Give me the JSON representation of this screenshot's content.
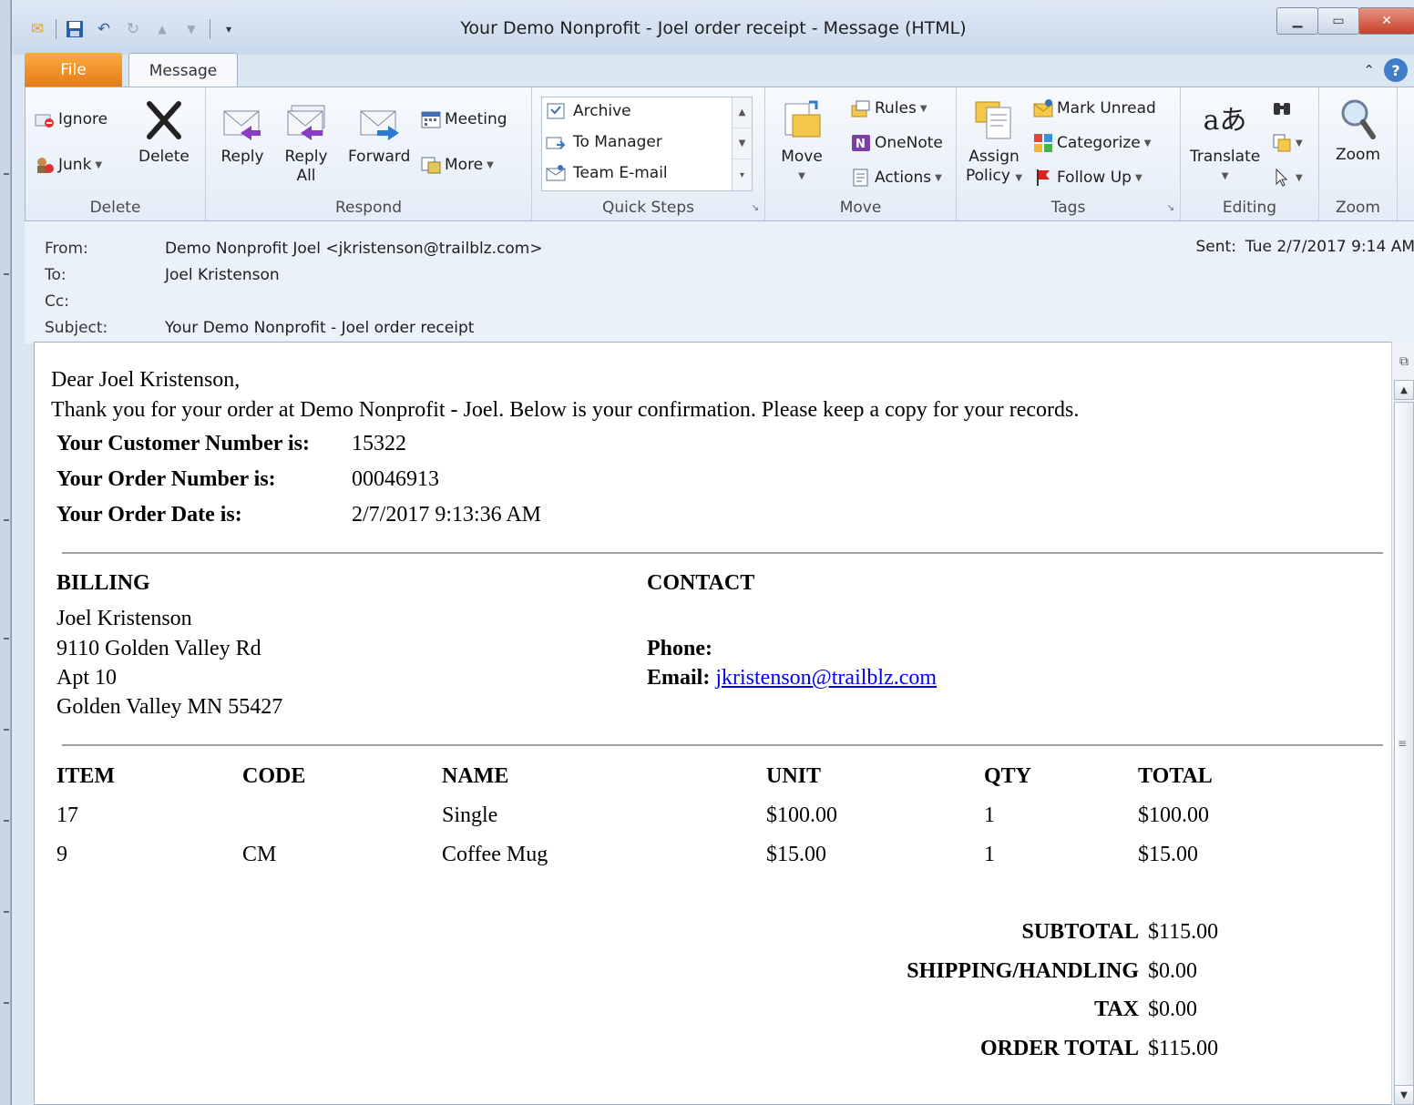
{
  "window": {
    "title": "Your Demo Nonprofit - Joel order receipt  -  Message (HTML)"
  },
  "tabs": {
    "file": "File",
    "message": "Message"
  },
  "ribbon": {
    "delete_group": {
      "ignore": "Ignore",
      "delete": "Delete",
      "junk": "Junk",
      "label": "Delete"
    },
    "respond_group": {
      "reply": "Reply",
      "reply_all_1": "Reply",
      "reply_all_2": "All",
      "forward": "Forward",
      "meeting": "Meeting",
      "more": "More",
      "label": "Respond"
    },
    "quick_steps": {
      "items": [
        "Archive",
        "To Manager",
        "Team E-mail"
      ],
      "label": "Quick Steps"
    },
    "move_group": {
      "move": "Move",
      "rules": "Rules",
      "onenote": "OneNote",
      "actions": "Actions",
      "label": "Move"
    },
    "tags_group": {
      "assign_1": "Assign",
      "assign_2": "Policy",
      "mark_unread": "Mark Unread",
      "categorize": "Categorize",
      "follow_up": "Follow Up",
      "label": "Tags"
    },
    "editing_group": {
      "translate": "Translate",
      "label": "Editing"
    },
    "zoom_group": {
      "zoom": "Zoom",
      "label": "Zoom"
    }
  },
  "header": {
    "from_label": "From:",
    "from_value": "Demo Nonprofit Joel <jkristenson@trailblz.com>",
    "to_label": "To:",
    "to_value": "Joel Kristenson",
    "cc_label": "Cc:",
    "subject_label": "Subject:",
    "subject_value": "Your Demo Nonprofit - Joel order receipt",
    "sent_label": "Sent:",
    "sent_value": "Tue 2/7/2017 9:14 AM"
  },
  "message": {
    "greeting": "Dear Joel Kristenson,",
    "intro": "Thank you for your order at Demo Nonprofit - Joel. Below is your confirmation. Please keep a copy for your records.",
    "customer_label": "Your Customer Number is:",
    "customer_value": "15322",
    "order_label": "Your Order Number is:",
    "order_value": "00046913",
    "date_label": "Your Order Date is:",
    "date_value": "2/7/2017 9:13:36 AM",
    "billing": {
      "heading": "BILLING",
      "lines": [
        "Joel Kristenson",
        "9110 Golden Valley Rd",
        "Apt 10",
        "Golden Valley MN 55427"
      ]
    },
    "contact": {
      "heading": "CONTACT",
      "phone_label": "Phone:",
      "email_label": "Email:",
      "email_value": "jkristenson@trailblz.com"
    },
    "items": {
      "headers": [
        "ITEM",
        "CODE",
        "NAME",
        "UNIT",
        "QTY",
        "TOTAL"
      ],
      "rows": [
        [
          "17",
          "",
          "Single",
          "$100.00",
          "1",
          "$100.00"
        ],
        [
          "9",
          "CM",
          "Coffee Mug",
          "$15.00",
          "1",
          "$15.00"
        ]
      ]
    },
    "totals": {
      "subtotal_label": "SUBTOTAL",
      "subtotal_value": "$115.00",
      "shipping_label": "SHIPPING/HANDLING",
      "shipping_value": "$0.00",
      "tax_label": "TAX",
      "tax_value": "$0.00",
      "order_total_label": "ORDER TOTAL",
      "order_total_value": "$115.00"
    }
  }
}
